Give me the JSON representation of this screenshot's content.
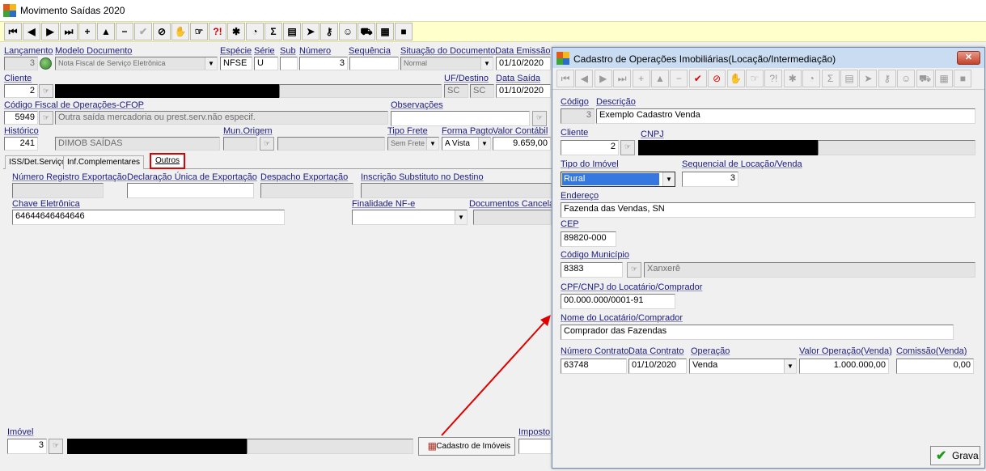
{
  "main_window": {
    "title": "Movimento Saídas 2020"
  },
  "toolbar": {
    "buttons": [
      {
        "name": "first-record",
        "glyph": "⏮"
      },
      {
        "name": "prior-record",
        "glyph": "◀"
      },
      {
        "name": "next-record",
        "glyph": "▶"
      },
      {
        "name": "last-record",
        "glyph": "⏭"
      },
      {
        "name": "insert",
        "glyph": "+"
      },
      {
        "name": "edit",
        "glyph": "▲"
      },
      {
        "name": "delete",
        "glyph": "−"
      },
      {
        "name": "post",
        "glyph": "✔"
      },
      {
        "name": "cancel",
        "glyph": "⊘"
      },
      {
        "name": "hand",
        "glyph": "✋"
      },
      {
        "name": "lookup",
        "glyph": "☞"
      },
      {
        "name": "help",
        "glyph": "?!"
      },
      {
        "name": "tools",
        "glyph": "✱"
      },
      {
        "name": "clock",
        "glyph": "◔"
      },
      {
        "name": "sum",
        "glyph": "Σ"
      },
      {
        "name": "print",
        "glyph": "▤"
      },
      {
        "name": "export",
        "glyph": "➤"
      },
      {
        "name": "key",
        "glyph": "⚷"
      },
      {
        "name": "people",
        "glyph": "☺"
      },
      {
        "name": "truck",
        "glyph": "⛟"
      },
      {
        "name": "calendar",
        "glyph": "▦"
      },
      {
        "name": "stop",
        "glyph": "■"
      }
    ]
  },
  "form": {
    "lancamento_label": "Lançamento",
    "lancamento": "3",
    "modelo_label": "Modelo Documento",
    "modelo": "Nota Fiscal de Serviço Eletrônica",
    "especie_label": "Espécie",
    "especie": "NFSE",
    "serie_label": "Série",
    "serie": "U",
    "sub_label": "Sub",
    "sub": "",
    "numero_label": "Número",
    "numero": "3",
    "sequencia_label": "Sequência",
    "sequencia": "",
    "situacao_label": "Situação do Documento",
    "situacao": "Normal",
    "data_emissao_label": "Data Emissão",
    "data_emissao": "01/10/2020",
    "cliente_label": "Cliente",
    "cliente": "2",
    "uf_label": "UF/Destino",
    "uf1": "SC",
    "uf2": "SC",
    "data_saida_label": "Data Saída",
    "data_saida": "01/10/2020",
    "cfop_label": "Código Fiscal de Operações-CFOP",
    "cfop": "5949",
    "cfop_desc": "Outra saída mercadoria ou prest.serv.não especif.",
    "observacoes_label": "Observações",
    "historico_label": "Histórico",
    "historico": "241",
    "historico_desc": "DIMOB SAÍDAS",
    "mun_origem_label": "Mun.Origem",
    "tipo_frete_label": "Tipo Frete",
    "tipo_frete": "Sem Frete",
    "forma_pagto_label": "Forma Pagto",
    "forma_pagto": "A Vista",
    "valor_contabil_label": "Valor Contábil",
    "valor_contabil": "9.659,00"
  },
  "tabs": [
    {
      "label": "ISS/Det.Serviços"
    },
    {
      "label": "Inf.Complementares"
    },
    {
      "label": "Outros"
    }
  ],
  "outros": {
    "num_reg_exp_label": "Número Registro Exportação",
    "decl_unica_label": "Declaração Única de Exportação",
    "despacho_label": "Despacho Exportação",
    "insc_subst_label": "Inscrição Substituto no Destino",
    "chave_label": "Chave Eletrônica",
    "chave": "64644646464646",
    "finalidade_label": "Finalidade NF-e",
    "docs_cancel_label": "Documentos Cancela"
  },
  "bottom": {
    "imovel_label": "Imóvel",
    "imovel": "3",
    "cadastro_button": "Cadastro de Imóveis",
    "imposto_label": "Imposto"
  },
  "dialog": {
    "title": "Cadastro de Operações Imobiliárias(Locação/Intermediação)",
    "toolbar_glyphs": [
      "⏮",
      "◀",
      "▶",
      "⏭",
      "+",
      "▲",
      "−",
      "✔",
      "⊘",
      "✋",
      "☞",
      "?!",
      "✱",
      "◔",
      "Σ",
      "▤",
      "➤",
      "⚷",
      "☺",
      "⛟",
      "▦",
      "■"
    ],
    "codigo_label": "Código",
    "codigo": "3",
    "descricao_label": "Descrição",
    "descricao": "Exemplo Cadastro Venda",
    "cliente_label": "Cliente",
    "cliente": "2",
    "cnpj_label": "CNPJ",
    "tipo_imovel_label": "Tipo do Imóvel",
    "tipo_imovel": "Rural",
    "seq_label": "Sequencial de Locação/Venda",
    "seq": "3",
    "endereco_label": "Endereço",
    "endereco": "Fazenda das Vendas, SN",
    "cep_label": "CEP",
    "cep": "89820-000",
    "cod_mun_label": "Código Município",
    "cod_mun": "8383",
    "municipio": "Xanxerê",
    "cpf_label": "CPF/CNPJ do Locatário/Comprador",
    "cpf": "00.000.000/0001-91",
    "nome_label": "Nome do Locatário/Comprador",
    "nome": "Comprador das Fazendas",
    "num_contrato_label": "Número Contrato",
    "num_contrato": "63748",
    "data_contrato_label": "Data Contrato",
    "data_contrato": "01/10/2020",
    "operacao_label": "Operação",
    "operacao": "Venda",
    "valor_label": "Valor Operação(Venda)",
    "valor": "1.000.000,00",
    "comissao_label": "Comissão(Venda)",
    "comissao": "0,00",
    "grava_button": "Grava"
  }
}
